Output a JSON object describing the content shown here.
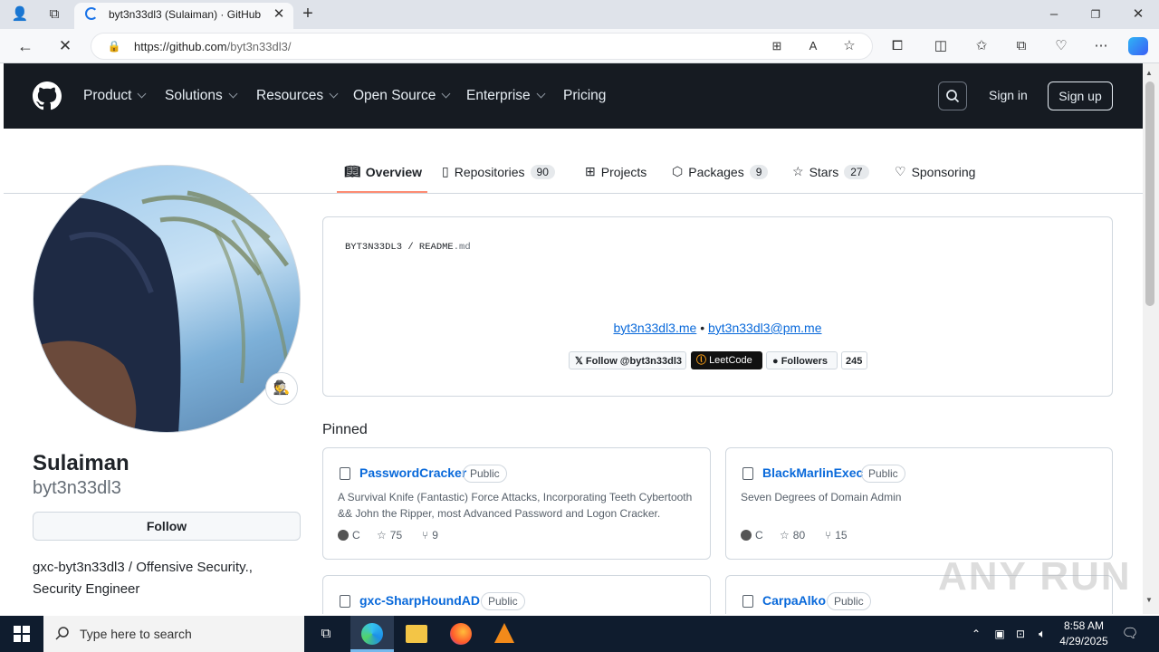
{
  "browser": {
    "tab_title": "byt3n33dl3 (Sulaiman) · GitHub",
    "url_host": "https://github.com",
    "url_path": "/byt3n33dl3/"
  },
  "nav": {
    "items": [
      "Product",
      "Solutions",
      "Resources",
      "Open Source",
      "Enterprise"
    ],
    "pricing": "Pricing",
    "sign_in": "Sign in",
    "sign_up": "Sign up"
  },
  "tabs": [
    {
      "label": "Overview"
    },
    {
      "label": "Repositories",
      "count": "90"
    },
    {
      "label": "Projects"
    },
    {
      "label": "Packages",
      "count": "9"
    },
    {
      "label": "Stars",
      "count": "27"
    },
    {
      "label": "Sponsoring"
    }
  ],
  "profile": {
    "name": "Sulaiman",
    "username": "byt3n33dl3",
    "follow_label": "Follow",
    "bio": "gxc-byt3n33dl3 / Offensive Security., Security Engineer",
    "status_emoji": "🕵"
  },
  "readme": {
    "path_owner": "BYT3N33DL3",
    "path_sep": " / ",
    "path_file": "README",
    "path_ext": ".md",
    "link_site": "byt3n33dl3.me",
    "link_sep": " • ",
    "link_email": "byt3n33dl3@pm.me",
    "badge_x": "Follow @byt3n33dl3",
    "badge_leetcode": "LeetCode",
    "badge_followers": "Followers",
    "badge_followers_count": "245"
  },
  "pinned": {
    "heading": "Pinned",
    "repos": [
      {
        "name": "PasswordCracker",
        "visibility": "Public",
        "desc": "A Survival Knife (Fantastic) Force Attacks, Incorporating Teeth Cybertooth && John the Ripper, most Advanced Password and Logon Cracker.",
        "lang": "C",
        "stars": "75",
        "forks": "9"
      },
      {
        "name": "BlackMarlinExec",
        "visibility": "Public",
        "desc": "Seven Degrees of Domain Admin",
        "lang": "C",
        "stars": "80",
        "forks": "15"
      },
      {
        "name": "gxc-SharpHoundAD",
        "visibility": "Public"
      },
      {
        "name": "CarpaAlko",
        "visibility": "Public"
      }
    ]
  },
  "watermark": "ANY RUN",
  "taskbar": {
    "search_placeholder": "Type here to search",
    "time": "8:58 AM",
    "date": "4/29/2025"
  },
  "colors": {
    "header_bg": "#161b22",
    "link": "#0969da",
    "tab_accent": "#fd8c73",
    "lang_c": "#555555"
  }
}
